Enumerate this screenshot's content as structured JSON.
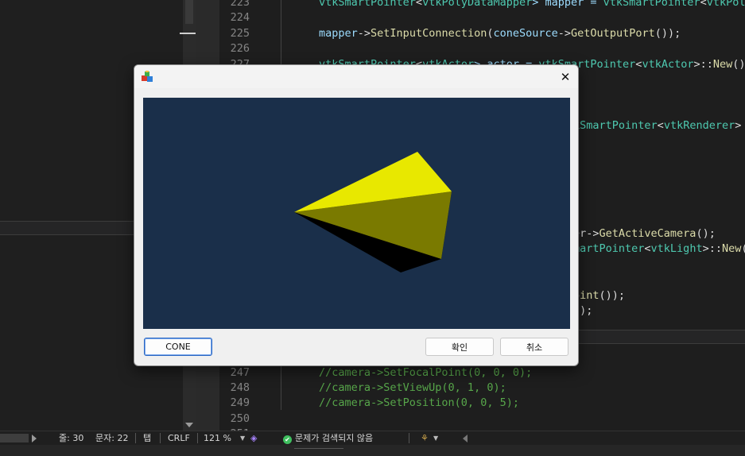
{
  "ide": {
    "code_lines": [
      {
        "num": "223",
        "parts": [
          [
            "vtkSmartPointer",
            "c-type"
          ],
          [
            "<",
            ""
          ],
          [
            "vtkPolyDataMapper",
            "c-type"
          ],
          [
            "> mapper = ",
            "c-var"
          ],
          [
            "vtkSmartPointer",
            "c-type"
          ],
          [
            "<",
            ""
          ],
          [
            "vtkPolyDa",
            "c-type"
          ]
        ]
      },
      {
        "num": "224",
        "parts": []
      },
      {
        "num": "225",
        "parts": [
          [
            "mapper",
            "c-var"
          ],
          [
            "->",
            ""
          ],
          [
            "SetInputConnection",
            "c-fn"
          ],
          [
            "(",
            ""
          ],
          [
            "coneSource",
            "c-var"
          ],
          [
            "->",
            ""
          ],
          [
            "GetOutputPort",
            "c-fn"
          ],
          [
            "());",
            ""
          ]
        ]
      },
      {
        "num": "226",
        "parts": []
      },
      {
        "num": "227",
        "parts": [
          [
            "vtkSmartPointer",
            "c-type"
          ],
          [
            "<",
            ""
          ],
          [
            "vtkActor",
            "c-type"
          ],
          [
            "> actor = ",
            "c-var"
          ],
          [
            "vtkSmartPointer",
            "c-type"
          ],
          [
            "<",
            ""
          ],
          [
            "vtkActor",
            "c-type"
          ],
          [
            ">::",
            ""
          ],
          [
            "New",
            "c-fn"
          ],
          [
            "();",
            ""
          ]
        ]
      }
    ],
    "hidden_right_lines": [
      {
        "row": 8,
        "parts": [
          [
            "kSmartPointer",
            "c-type"
          ],
          [
            "<",
            ""
          ],
          [
            "vtkRenderer",
            "c-type"
          ],
          [
            ">",
            ""
          ]
        ]
      },
      {
        "row": 15,
        "parts": [
          [
            "er->",
            ""
          ],
          [
            "GetActiveCamera",
            "c-fn"
          ],
          [
            "();",
            ""
          ]
        ]
      },
      {
        "row": 16,
        "parts": [
          [
            "martPointer",
            "c-type"
          ],
          [
            "<",
            ""
          ],
          [
            "vtkLight",
            "c-type"
          ],
          [
            ">::",
            ""
          ],
          [
            "New",
            "c-fn"
          ],
          [
            "(",
            ""
          ]
        ]
      },
      {
        "row": 19,
        "parts": [
          [
            "oint",
            "c-fn"
          ],
          [
            "());",
            ""
          ]
        ]
      },
      {
        "row": 20,
        "parts": [
          [
            "));",
            ""
          ]
        ]
      }
    ],
    "tail_lines": [
      {
        "num": "247",
        "parts": [
          [
            "//camera->SetFocalPoint(0, 0, 0);",
            "c-cmt"
          ]
        ]
      },
      {
        "num": "248",
        "parts": [
          [
            "//camera->SetViewUp(0, 1, 0);",
            "c-cmt"
          ]
        ]
      },
      {
        "num": "249",
        "parts": [
          [
            "//camera->SetPosition(0, 0, 5);",
            "c-cmt"
          ]
        ]
      },
      {
        "num": "250",
        "parts": []
      },
      {
        "num": "251",
        "parts": []
      }
    ]
  },
  "statusbar": {
    "line": "줄: 30",
    "column": "문자: 22",
    "indent": "탭",
    "eol": "CRLF",
    "zoom": "121 %",
    "issues": "문제가 검색되지 않음"
  },
  "dialog": {
    "cone_button": "CONE",
    "ok_button": "확인",
    "cancel_button": "취소",
    "close_glyph": "✕",
    "viewport_background": "#1a2f4a",
    "cone_colors": {
      "lit": "#e8e800",
      "shaded": "#7a7a00",
      "dark": "#000000"
    }
  }
}
